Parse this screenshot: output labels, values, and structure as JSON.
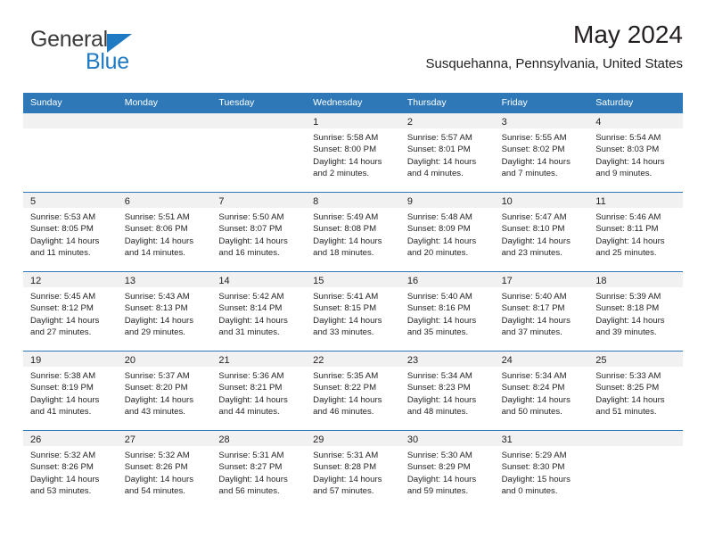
{
  "brand": {
    "name_part1": "General",
    "name_part2": "Blue",
    "triangle_color": "#1f7ac4",
    "text_color": "#3b3b3b",
    "accent_color": "#1f7ac4"
  },
  "header": {
    "title": "May 2024",
    "subtitle": "Susquehanna, Pennsylvania, United States"
  },
  "theme": {
    "header_blue": "#2e78b8",
    "daynum_band": "#f1f1f1",
    "text": "#231f20"
  },
  "weekdays": [
    "Sunday",
    "Monday",
    "Tuesday",
    "Wednesday",
    "Thursday",
    "Friday",
    "Saturday"
  ],
  "weeks": [
    [
      {
        "day": "",
        "lines": []
      },
      {
        "day": "",
        "lines": []
      },
      {
        "day": "",
        "lines": []
      },
      {
        "day": "1",
        "lines": [
          "Sunrise: 5:58 AM",
          "Sunset: 8:00 PM",
          "Daylight: 14 hours",
          "and 2 minutes."
        ]
      },
      {
        "day": "2",
        "lines": [
          "Sunrise: 5:57 AM",
          "Sunset: 8:01 PM",
          "Daylight: 14 hours",
          "and 4 minutes."
        ]
      },
      {
        "day": "3",
        "lines": [
          "Sunrise: 5:55 AM",
          "Sunset: 8:02 PM",
          "Daylight: 14 hours",
          "and 7 minutes."
        ]
      },
      {
        "day": "4",
        "lines": [
          "Sunrise: 5:54 AM",
          "Sunset: 8:03 PM",
          "Daylight: 14 hours",
          "and 9 minutes."
        ]
      }
    ],
    [
      {
        "day": "5",
        "lines": [
          "Sunrise: 5:53 AM",
          "Sunset: 8:05 PM",
          "Daylight: 14 hours",
          "and 11 minutes."
        ]
      },
      {
        "day": "6",
        "lines": [
          "Sunrise: 5:51 AM",
          "Sunset: 8:06 PM",
          "Daylight: 14 hours",
          "and 14 minutes."
        ]
      },
      {
        "day": "7",
        "lines": [
          "Sunrise: 5:50 AM",
          "Sunset: 8:07 PM",
          "Daylight: 14 hours",
          "and 16 minutes."
        ]
      },
      {
        "day": "8",
        "lines": [
          "Sunrise: 5:49 AM",
          "Sunset: 8:08 PM",
          "Daylight: 14 hours",
          "and 18 minutes."
        ]
      },
      {
        "day": "9",
        "lines": [
          "Sunrise: 5:48 AM",
          "Sunset: 8:09 PM",
          "Daylight: 14 hours",
          "and 20 minutes."
        ]
      },
      {
        "day": "10",
        "lines": [
          "Sunrise: 5:47 AM",
          "Sunset: 8:10 PM",
          "Daylight: 14 hours",
          "and 23 minutes."
        ]
      },
      {
        "day": "11",
        "lines": [
          "Sunrise: 5:46 AM",
          "Sunset: 8:11 PM",
          "Daylight: 14 hours",
          "and 25 minutes."
        ]
      }
    ],
    [
      {
        "day": "12",
        "lines": [
          "Sunrise: 5:45 AM",
          "Sunset: 8:12 PM",
          "Daylight: 14 hours",
          "and 27 minutes."
        ]
      },
      {
        "day": "13",
        "lines": [
          "Sunrise: 5:43 AM",
          "Sunset: 8:13 PM",
          "Daylight: 14 hours",
          "and 29 minutes."
        ]
      },
      {
        "day": "14",
        "lines": [
          "Sunrise: 5:42 AM",
          "Sunset: 8:14 PM",
          "Daylight: 14 hours",
          "and 31 minutes."
        ]
      },
      {
        "day": "15",
        "lines": [
          "Sunrise: 5:41 AM",
          "Sunset: 8:15 PM",
          "Daylight: 14 hours",
          "and 33 minutes."
        ]
      },
      {
        "day": "16",
        "lines": [
          "Sunrise: 5:40 AM",
          "Sunset: 8:16 PM",
          "Daylight: 14 hours",
          "and 35 minutes."
        ]
      },
      {
        "day": "17",
        "lines": [
          "Sunrise: 5:40 AM",
          "Sunset: 8:17 PM",
          "Daylight: 14 hours",
          "and 37 minutes."
        ]
      },
      {
        "day": "18",
        "lines": [
          "Sunrise: 5:39 AM",
          "Sunset: 8:18 PM",
          "Daylight: 14 hours",
          "and 39 minutes."
        ]
      }
    ],
    [
      {
        "day": "19",
        "lines": [
          "Sunrise: 5:38 AM",
          "Sunset: 8:19 PM",
          "Daylight: 14 hours",
          "and 41 minutes."
        ]
      },
      {
        "day": "20",
        "lines": [
          "Sunrise: 5:37 AM",
          "Sunset: 8:20 PM",
          "Daylight: 14 hours",
          "and 43 minutes."
        ]
      },
      {
        "day": "21",
        "lines": [
          "Sunrise: 5:36 AM",
          "Sunset: 8:21 PM",
          "Daylight: 14 hours",
          "and 44 minutes."
        ]
      },
      {
        "day": "22",
        "lines": [
          "Sunrise: 5:35 AM",
          "Sunset: 8:22 PM",
          "Daylight: 14 hours",
          "and 46 minutes."
        ]
      },
      {
        "day": "23",
        "lines": [
          "Sunrise: 5:34 AM",
          "Sunset: 8:23 PM",
          "Daylight: 14 hours",
          "and 48 minutes."
        ]
      },
      {
        "day": "24",
        "lines": [
          "Sunrise: 5:34 AM",
          "Sunset: 8:24 PM",
          "Daylight: 14 hours",
          "and 50 minutes."
        ]
      },
      {
        "day": "25",
        "lines": [
          "Sunrise: 5:33 AM",
          "Sunset: 8:25 PM",
          "Daylight: 14 hours",
          "and 51 minutes."
        ]
      }
    ],
    [
      {
        "day": "26",
        "lines": [
          "Sunrise: 5:32 AM",
          "Sunset: 8:26 PM",
          "Daylight: 14 hours",
          "and 53 minutes."
        ]
      },
      {
        "day": "27",
        "lines": [
          "Sunrise: 5:32 AM",
          "Sunset: 8:26 PM",
          "Daylight: 14 hours",
          "and 54 minutes."
        ]
      },
      {
        "day": "28",
        "lines": [
          "Sunrise: 5:31 AM",
          "Sunset: 8:27 PM",
          "Daylight: 14 hours",
          "and 56 minutes."
        ]
      },
      {
        "day": "29",
        "lines": [
          "Sunrise: 5:31 AM",
          "Sunset: 8:28 PM",
          "Daylight: 14 hours",
          "and 57 minutes."
        ]
      },
      {
        "day": "30",
        "lines": [
          "Sunrise: 5:30 AM",
          "Sunset: 8:29 PM",
          "Daylight: 14 hours",
          "and 59 minutes."
        ]
      },
      {
        "day": "31",
        "lines": [
          "Sunrise: 5:29 AM",
          "Sunset: 8:30 PM",
          "Daylight: 15 hours",
          "and 0 minutes."
        ]
      },
      {
        "day": "",
        "lines": []
      }
    ]
  ]
}
